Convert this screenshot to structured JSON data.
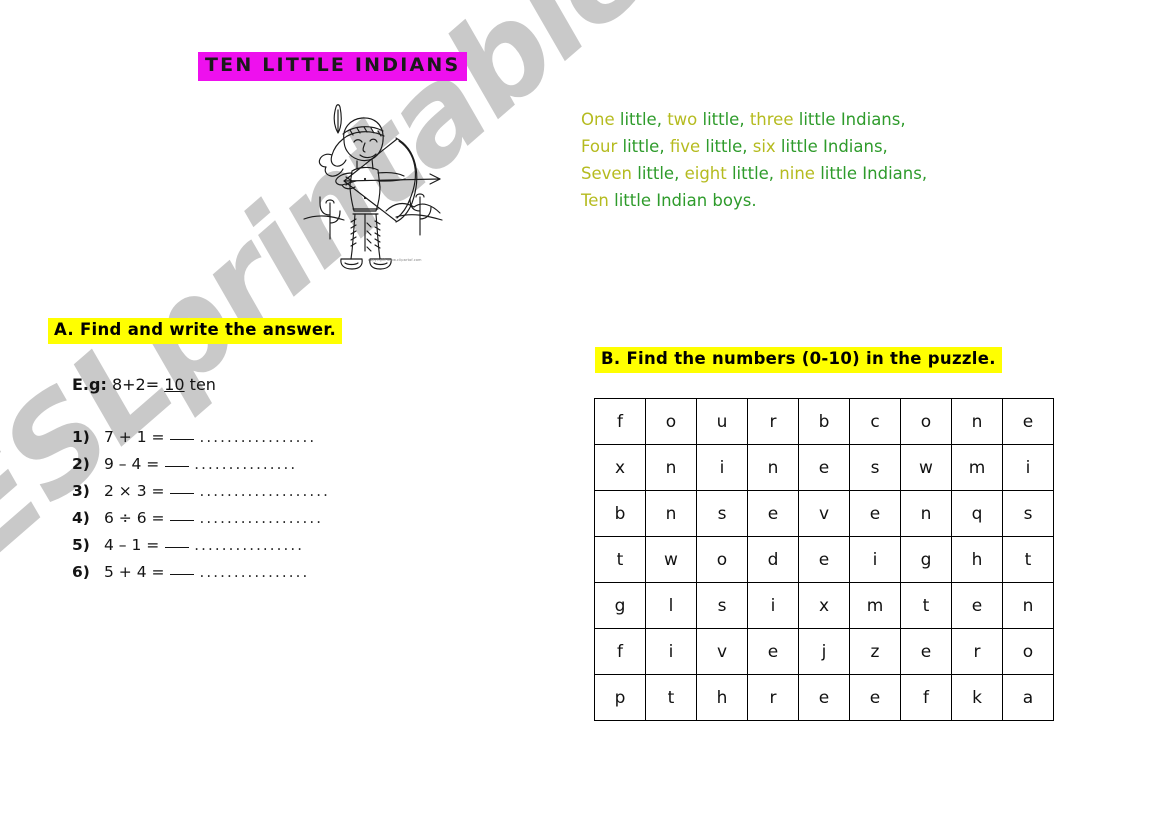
{
  "worksheet": {
    "title": "TEN LITTLE INDIANS",
    "title_bg": "#ee10ee",
    "highlight_bg": "#ffff00"
  },
  "illustration": {
    "name": "native-american-boy-with-bow-and-arrow",
    "credit": "copyright www.clipartof.com"
  },
  "lyrics": {
    "colors": {
      "number_word": "#b5bb1f",
      "text": "#2e9b2b"
    },
    "lines": [
      {
        "parts": [
          {
            "t": "One",
            "c": "num"
          },
          {
            "t": " little, ",
            "c": "grn"
          },
          {
            "t": "two",
            "c": "num"
          },
          {
            "t": " little, ",
            "c": "grn"
          },
          {
            "t": "three",
            "c": "num"
          },
          {
            "t": " little Indians,",
            "c": "grn"
          }
        ]
      },
      {
        "parts": [
          {
            "t": "Four",
            "c": "num"
          },
          {
            "t": " little, ",
            "c": "grn"
          },
          {
            "t": "five",
            "c": "num"
          },
          {
            "t": " little, ",
            "c": "grn"
          },
          {
            "t": "six",
            "c": "num"
          },
          {
            "t": " little Indians,",
            "c": "grn"
          }
        ]
      },
      {
        "parts": [
          {
            "t": "Seven",
            "c": "num"
          },
          {
            "t": " little, ",
            "c": "grn"
          },
          {
            "t": "eight",
            "c": "num"
          },
          {
            "t": " little, ",
            "c": "grn"
          },
          {
            "t": "nine",
            "c": "num"
          },
          {
            "t": " little Indians,",
            "c": "grn"
          }
        ]
      },
      {
        "parts": [
          {
            "t": "Ten",
            "c": "num"
          },
          {
            "t": " little Indian boys.",
            "c": "grn"
          }
        ]
      }
    ]
  },
  "section_a": {
    "heading": "A. Find and write the answer.",
    "example": {
      "label": "E.g:",
      "expression": "8+2=",
      "answer_number": "10",
      "answer_word": "ten"
    },
    "items": [
      {
        "num": "1)",
        "equation": "7 + 1 =",
        "dots": "................."
      },
      {
        "num": "2)",
        "equation": "9 – 4 =",
        "dots": "..............."
      },
      {
        "num": "3)",
        "equation": "2 × 3 =",
        "dots": "..................."
      },
      {
        "num": "4)",
        "equation": "6 ÷ 6 =",
        "dots": ".................."
      },
      {
        "num": "5)",
        "equation": "4 – 1 =",
        "dots": "................"
      },
      {
        "num": "6)",
        "equation": "5 + 4 =",
        "dots": "................"
      }
    ]
  },
  "section_b": {
    "heading": "B. Find the numbers (0-10) in the puzzle.",
    "grid": [
      [
        "f",
        "o",
        "u",
        "r",
        "b",
        "c",
        "o",
        "n",
        "e"
      ],
      [
        "x",
        "n",
        "i",
        "n",
        "e",
        "s",
        "w",
        "m",
        "i"
      ],
      [
        "b",
        "n",
        "s",
        "e",
        "v",
        "e",
        "n",
        "q",
        "s"
      ],
      [
        "t",
        "w",
        "o",
        "d",
        "e",
        "i",
        "g",
        "h",
        "t"
      ],
      [
        "g",
        "l",
        "s",
        "i",
        "x",
        "m",
        "t",
        "e",
        "n"
      ],
      [
        "f",
        "i",
        "v",
        "e",
        "j",
        "z",
        "e",
        "r",
        "o"
      ],
      [
        "p",
        "t",
        "h",
        "r",
        "e",
        "e",
        "f",
        "k",
        "a"
      ]
    ]
  },
  "watermark": {
    "text": "ESLprintables.com",
    "color": "#c9c9c9"
  }
}
